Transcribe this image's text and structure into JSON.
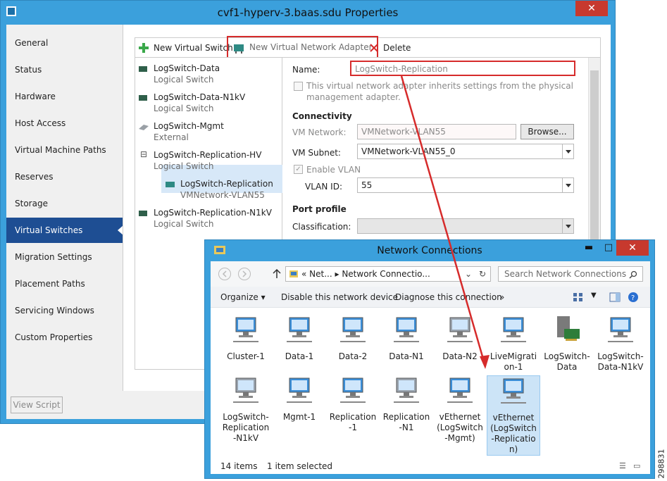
{
  "properties_window": {
    "title": "cvf1-hyperv-3.baas.sdu Properties",
    "close": "✕",
    "nav": [
      "General",
      "Status",
      "Hardware",
      "Host Access",
      "Virtual Machine Paths",
      "Reserves",
      "Storage",
      "Virtual Switches",
      "Migration Settings",
      "Placement Paths",
      "Servicing Windows",
      "Custom Properties"
    ],
    "nav_selected_index": 7,
    "toolbar": {
      "new_switch": "New Virtual Switch",
      "new_adapter": "New Virtual Network Adapter",
      "delete": "Delete"
    },
    "tree": [
      {
        "main": "LogSwitch-Data",
        "sub": "Logical Switch"
      },
      {
        "main": "LogSwitch-Data-N1kV",
        "sub": "Logical Switch"
      },
      {
        "main": "LogSwitch-Mgmt",
        "sub": "External"
      },
      {
        "main": "LogSwitch-Replication-HV",
        "sub": "Logical Switch",
        "toggle": "⊟"
      },
      {
        "main": "LogSwitch-Replication",
        "sub": "VMNetwork-VLAN55"
      },
      {
        "main": "LogSwitch-Replication-N1kV",
        "sub": "Logical Switch"
      }
    ],
    "details": {
      "name_label": "Name:",
      "name_value": "LogSwitch-Replication",
      "inherit_text_1": "This virtual network adapter inherits settings from the physical",
      "inherit_text_2": "management adapter.",
      "connectivity": "Connectivity",
      "vm_network_label": "VM Network:",
      "vm_network_value": "VMNetwork-VLAN55",
      "browse": "Browse...",
      "vm_subnet_label": "VM Subnet:",
      "vm_subnet_value": "VMNetwork-VLAN55_0",
      "enable_vlan": "Enable VLAN",
      "enable_vlan_check": "✓",
      "vlan_id_label": "VLAN ID:",
      "vlan_id_value": "55",
      "port_profile": "Port profile",
      "classification_label": "Classification:",
      "classification_value": ""
    },
    "view_script": "View Script"
  },
  "network_window": {
    "title": "Network Connections",
    "minimize": "▬",
    "maximize": "□",
    "close": "✕",
    "address": "«  Net...  ▸  Network Connectio...",
    "search_placeholder": "Search Network Connections",
    "commands": {
      "organize": "Organize ▾",
      "disable": "Disable this network device",
      "diagnose": "Diagnose this connection",
      "more": "»"
    },
    "items": [
      [
        "Cluster-1"
      ],
      [
        "Data-1"
      ],
      [
        "Data-2"
      ],
      [
        "Data-N1"
      ],
      [
        "Data-N2"
      ],
      [
        "LiveMigrati",
        "on-1"
      ],
      [
        "LogSwitch-",
        "Data"
      ],
      [
        "LogSwitch-",
        "Data-N1kV"
      ],
      [
        "LogSwitch-",
        "Replication",
        "-N1kV"
      ],
      [
        "Mgmt-1"
      ],
      [
        "Replication",
        "-1"
      ],
      [
        "Replication",
        "-N1"
      ],
      [
        "vEthernet",
        "(LogSwitch",
        "-Mgmt)"
      ],
      [
        "vEthernet",
        "(LogSwitch",
        "-Replicatio",
        "n)"
      ]
    ],
    "selected_item_index": 13,
    "status_count": "14 items",
    "status_selected": "1 item selected"
  },
  "figure_id": "298831",
  "colors": {
    "title_bar": "#3ba0dc",
    "nav_selected": "#1e4e93",
    "highlight_red": "#d62b2b",
    "close_red": "#c7392e"
  }
}
